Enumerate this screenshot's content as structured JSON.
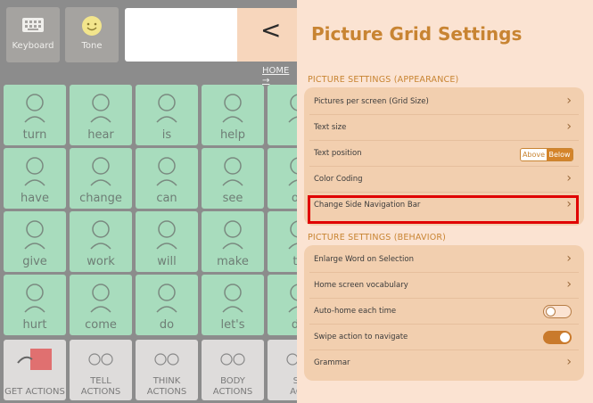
{
  "left": {
    "keyboard_label": "Keyboard",
    "tone_label": "Tone",
    "home_label": "HOME",
    "home_arrow": "→",
    "back_glyph": "<",
    "cells": [
      [
        "turn",
        "hear",
        "is",
        "help",
        ""
      ],
      [
        "have",
        "change",
        "can",
        "see",
        "op"
      ],
      [
        "give",
        "work",
        "will",
        "make",
        "th"
      ],
      [
        "hurt",
        "come",
        "do",
        "let's",
        "do"
      ]
    ],
    "actions": [
      "GET ACTIONS",
      "TELL\nACTIONS",
      "THINK\nACTIONS",
      "BODY\nACTIONS",
      "SE\nACT"
    ]
  },
  "panel": {
    "title": "Picture Grid Settings",
    "appearance_header": "PICTURE SETTINGS (APPEARANCE)",
    "appearance_rows": [
      "Pictures per screen (Grid Size)",
      "Text size",
      "Text position",
      "Color Coding",
      "Change Side Navigation Bar"
    ],
    "text_position": {
      "above": "Above",
      "below": "Below",
      "selected": "Below"
    },
    "behavior_header": "PICTURE SETTINGS (BEHAVIOR)",
    "behavior_rows": [
      "Enlarge Word on Selection",
      "Home screen vocabulary",
      "Auto-home each time",
      "Swipe action to navigate",
      "Grammar"
    ],
    "auto_home_on": false,
    "swipe_on": true,
    "chevron": "›"
  },
  "colors": {
    "accent": "#c88432",
    "panel_bg": "#fbe3d2",
    "group_bg": "#f2cfaf",
    "highlight": "#e00000",
    "cell_green": "#a8dcbd"
  }
}
